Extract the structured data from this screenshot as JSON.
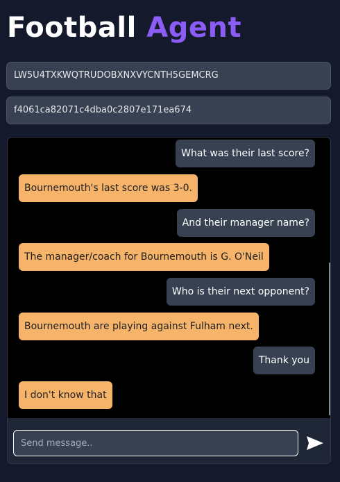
{
  "header": {
    "title_part1": "Football",
    "title_part2": "Agent"
  },
  "credentials": {
    "api_key": "LW5U4TXKWQTRUDOBXNXVYCNTH5GEMCRG",
    "session_id": "f4061ca82071c4dba0c2807e171ea674"
  },
  "chat": {
    "messages": [
      {
        "role": "user",
        "text": "What was their last score?"
      },
      {
        "role": "agent",
        "text": "Bournemouth's last score was 3-0."
      },
      {
        "role": "user",
        "text": "And their manager name?"
      },
      {
        "role": "agent",
        "text": "The manager/coach for Bournemouth is G. O'Neil"
      },
      {
        "role": "user",
        "text": "Who is their next opponent?"
      },
      {
        "role": "agent",
        "text": "Bournemouth are playing against Fulham next."
      },
      {
        "role": "user",
        "text": "Thank you"
      },
      {
        "role": "agent",
        "text": "I don't know that"
      }
    ],
    "input_placeholder": "Send message..",
    "send_icon": "send-icon"
  },
  "colors": {
    "background": "#141a2b",
    "accent": "#8b5cf6",
    "user_bubble": "#374151",
    "agent_bubble": "#f6b36a"
  }
}
